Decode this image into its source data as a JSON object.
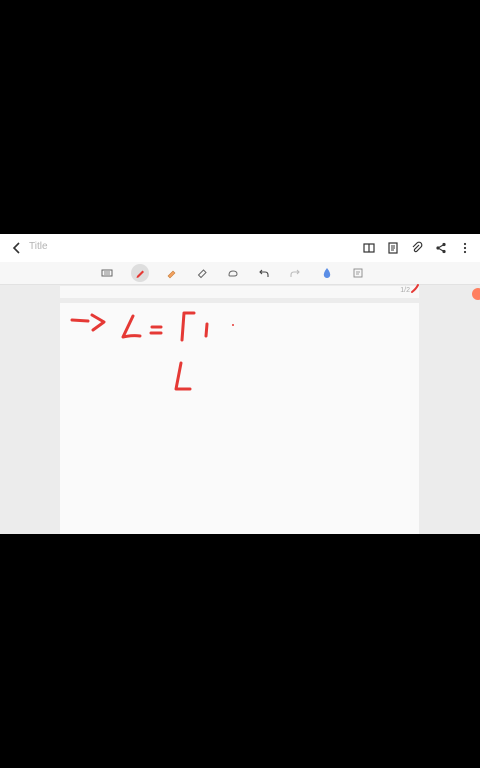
{
  "header": {
    "title_placeholder": "Title",
    "back_icon": "chevron-left-icon",
    "actions": [
      "book-icon",
      "page-icon",
      "attach-icon",
      "share-icon",
      "more-icon"
    ]
  },
  "toolbar": {
    "tools": [
      {
        "name": "keyboard-icon",
        "active": false
      },
      {
        "name": "pen-icon",
        "active": true
      },
      {
        "name": "highlighter-icon",
        "active": false
      },
      {
        "name": "eraser-icon",
        "active": false
      },
      {
        "name": "lasso-icon",
        "active": false
      },
      {
        "name": "undo-icon",
        "active": false
      },
      {
        "name": "redo-icon",
        "active": false
      },
      {
        "name": "ink-color-icon",
        "active": false
      },
      {
        "name": "text-insert-icon",
        "active": false
      }
    ]
  },
  "document": {
    "page_indicator": "1/2",
    "ink_color": "#e53935"
  }
}
